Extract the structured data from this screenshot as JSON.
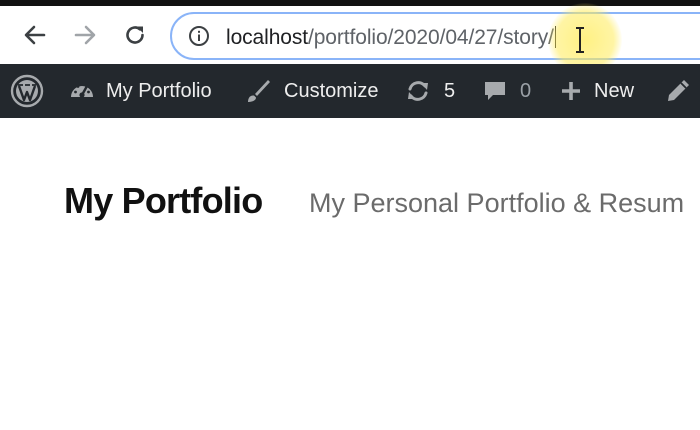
{
  "browser": {
    "url_host": "localhost",
    "url_path": "/portfolio/2020/04/27/",
    "url_typed": "story/"
  },
  "adminbar": {
    "site_name": "My Portfolio",
    "customize_label": "Customize",
    "updates_count": "5",
    "comments_count": "0",
    "new_label": "New"
  },
  "site": {
    "title": "My Portfolio",
    "description": "My Personal Portfolio & Resum"
  },
  "colors": {
    "adminbar_bg": "#23282d",
    "omnibox_border": "#8ab4f8",
    "cursor_highlight": "#ffec5a"
  },
  "icons": [
    "arrow-left-icon",
    "arrow-right-icon",
    "reload-icon",
    "info-icon",
    "wordpress-logo-icon",
    "dashboard-icon",
    "brush-icon",
    "updates-icon",
    "comment-icon",
    "plus-icon",
    "pencil-icon",
    "text-cursor-icon"
  ]
}
